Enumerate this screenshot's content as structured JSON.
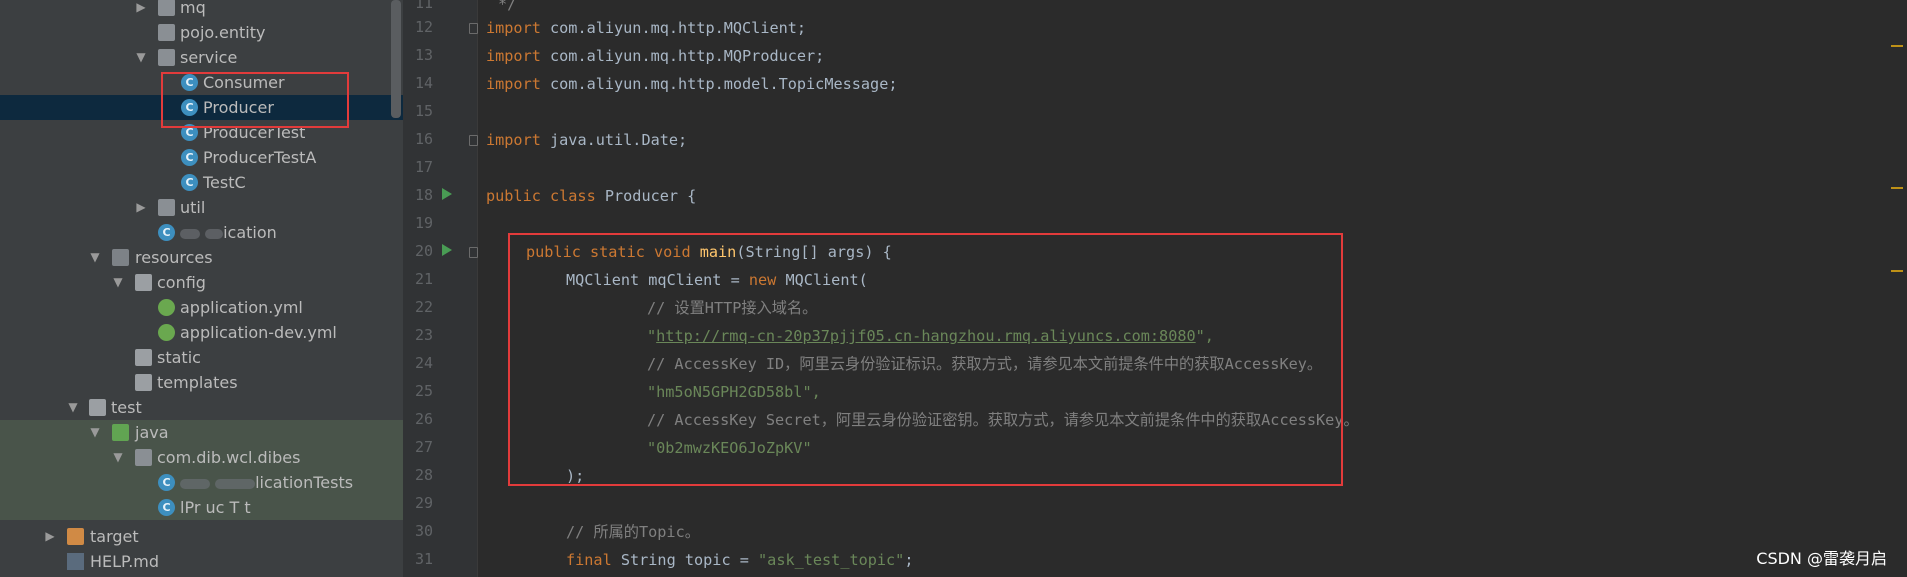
{
  "project_tree": {
    "items": [
      {
        "label": "mq",
        "icon": "package-folder-icon"
      },
      {
        "label": "pojo.entity",
        "icon": "package-folder-icon"
      },
      {
        "label": "service",
        "icon": "package-folder-icon"
      },
      {
        "label": "Consumer",
        "icon": "java-class-icon"
      },
      {
        "label": "Producer",
        "icon": "java-class-icon"
      },
      {
        "label": "ProducerTest",
        "icon": "java-class-icon"
      },
      {
        "label": "ProducerTestA",
        "icon": "java-class-icon"
      },
      {
        "label": "TestC",
        "icon": "java-class-icon"
      },
      {
        "label": "util",
        "icon": "package-folder-icon"
      },
      {
        "label": "ication",
        "icon": "java-class-icon"
      },
      {
        "label": "resources",
        "icon": "resources-folder-icon"
      },
      {
        "label": "config",
        "icon": "folder-icon"
      },
      {
        "label": "application.yml",
        "icon": "spring-yml-icon"
      },
      {
        "label": "application-dev.yml",
        "icon": "spring-yml-icon"
      },
      {
        "label": "static",
        "icon": "folder-icon"
      },
      {
        "label": "templates",
        "icon": "folder-icon"
      },
      {
        "label": "test",
        "icon": "folder-icon"
      },
      {
        "label": "java",
        "icon": "test-source-folder-icon"
      },
      {
        "label": "com.dib.wcl.dibes",
        "icon": "package-folder-icon"
      },
      {
        "label": "licationTests",
        "icon": "java-class-icon"
      },
      {
        "label": "lPr uc T t",
        "icon": "java-class-icon"
      },
      {
        "label": "target",
        "icon": "excluded-folder-icon"
      },
      {
        "label": "HELP.md",
        "icon": "markdown-file-icon"
      }
    ]
  },
  "editor": {
    "line_numbers": [
      "11",
      "12",
      "13",
      "14",
      "15",
      "16",
      "17",
      "18",
      "19",
      "20",
      "21",
      "22",
      "23",
      "24",
      "25",
      "26",
      "27",
      "28",
      "29",
      "30",
      "31"
    ],
    "lines": {
      "l11": "*/",
      "l12_kw": "import",
      "l12": " com.aliyun.mq.http.MQClient;",
      "l13_kw": "import",
      "l13": " com.aliyun.mq.http.MQProducer;",
      "l14_kw": "import",
      "l14": " com.aliyun.mq.http.model.TopicMessage;",
      "l16_kw": "import",
      "l16": " java.util.Date;",
      "l18_kw": "public class",
      "l18": " Producer {",
      "l20_kw": "public static void",
      "l20_fn": "main",
      "l20": "(String[] args) {",
      "l21_a": "MQClient mqClient = ",
      "l21_kw": "new",
      "l21_b": " MQClient(",
      "l22": "// 设置HTTP接入域名。",
      "l23_q1": "\"",
      "l23_url": "http://rmq-cn-20p37pjjf05.cn-hangzhou.rmq.aliyuncs.com:8080",
      "l23_q2": "\",",
      "l24": "// AccessKey ID，阿里云身份验证标识。获取方式，请参见本文前提条件中的获取AccessKey。",
      "l25": "\"hm5oN5GPH2GD58bl\",",
      "l26": "// AccessKey Secret，阿里云身份验证密钥。获取方式，请参见本文前提条件中的获取AccessKey。",
      "l27": "\"0b2mwzKEO6JoZpKV\"",
      "l28": ");",
      "l30": "// 所属的Topic。",
      "l31_kw": "final",
      "l31_a": " String topic = ",
      "l31_str": "\"ask_test_topic\"",
      "l31_b": ";"
    }
  },
  "watermark": "CSDN @雷袭月启",
  "colors": {
    "highlight_box": "#e23b3b",
    "keyword": "#cc7832",
    "string": "#6a8759",
    "comment": "#808080",
    "function": "#ffc66d"
  }
}
